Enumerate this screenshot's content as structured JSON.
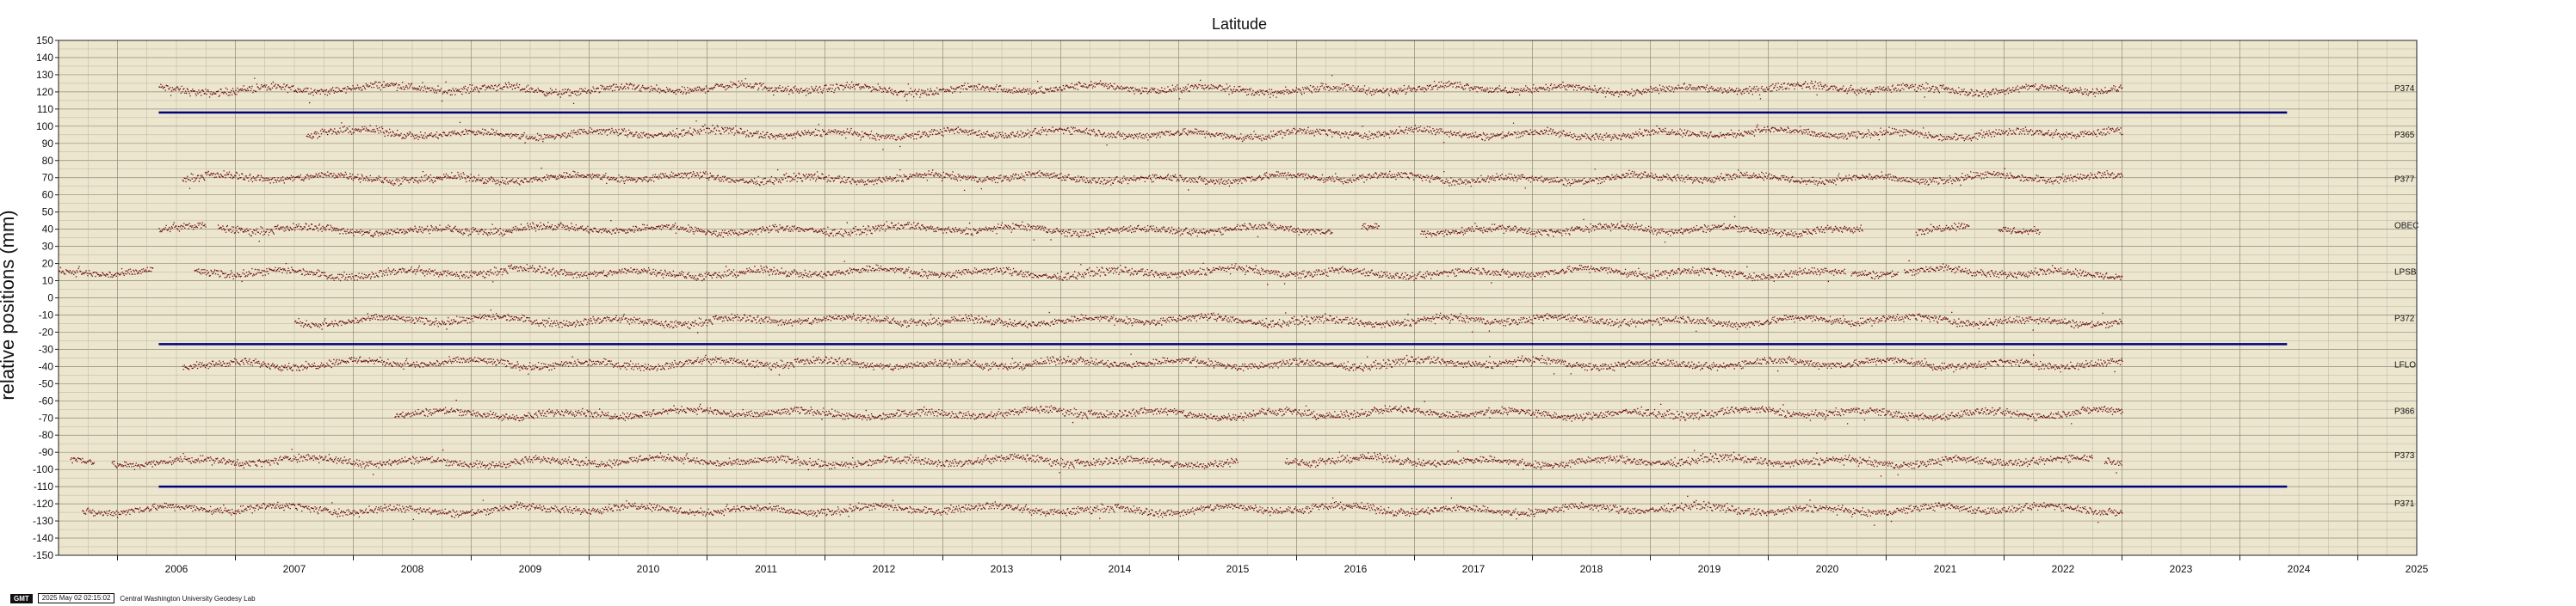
{
  "chart_data": {
    "type": "scatter",
    "title": "Latitude",
    "ylabel": "relative positions (mm)",
    "xlim": [
      2005.5,
      2025.5
    ],
    "ylim": [
      -150,
      150
    ],
    "y_ticks": [
      150,
      140,
      130,
      120,
      110,
      100,
      90,
      80,
      70,
      60,
      50,
      40,
      30,
      20,
      10,
      0,
      -10,
      -20,
      -30,
      -40,
      -50,
      -60,
      -70,
      -80,
      -90,
      -100,
      -110,
      -120,
      -130,
      -140,
      -150
    ],
    "x_ticks": [
      "2006",
      "2007",
      "2008",
      "2009",
      "2010",
      "2011",
      "2012",
      "2013",
      "2014",
      "2015",
      "2016",
      "2017",
      "2018",
      "2019",
      "2020",
      "2021",
      "2022",
      "2023",
      "2024",
      "2025"
    ],
    "grid": true,
    "background": "#ede6cf",
    "point_color": "#6b0c0c",
    "separator_color": "#000080",
    "separators": [
      {
        "y": 108,
        "x": [
          2006.35,
          2024.4
        ]
      },
      {
        "y": -27,
        "x": [
          2006.35,
          2024.4
        ]
      },
      {
        "y": -110,
        "x": [
          2006.35,
          2024.4
        ]
      }
    ],
    "series": [
      {
        "name": "P374",
        "label_y": 122,
        "offset": 122,
        "segments": [
          [
            2006.35,
            2023.0
          ]
        ]
      },
      {
        "name": "P365",
        "label_y": 95,
        "offset": 96,
        "segments": [
          [
            2007.6,
            2023.0
          ]
        ]
      },
      {
        "name": "P377",
        "label_y": 69,
        "offset": 70,
        "segments": [
          [
            2006.55,
            2023.0
          ]
        ]
      },
      {
        "name": "OBEC",
        "label_y": 42,
        "offset": 40,
        "segments": [
          [
            2006.35,
            2006.75
          ],
          [
            2006.85,
            2016.3
          ],
          [
            2016.55,
            2016.7
          ],
          [
            2017.05,
            2020.8
          ],
          [
            2021.25,
            2021.7
          ],
          [
            2021.95,
            2022.3
          ]
        ]
      },
      {
        "name": "LPSB",
        "label_y": 15,
        "offset": 15,
        "segments": [
          [
            2005.5,
            2006.3
          ],
          [
            2006.65,
            2020.65
          ],
          [
            2020.7,
            2021.1
          ],
          [
            2021.15,
            2023.0
          ]
        ]
      },
      {
        "name": "P372",
        "label_y": -12,
        "offset": -13,
        "segments": [
          [
            2007.5,
            2023.0
          ]
        ]
      },
      {
        "name": "LFLO",
        "label_y": -39,
        "offset": -38,
        "segments": [
          [
            2006.55,
            2023.0
          ]
        ]
      },
      {
        "name": "P366",
        "label_y": -66,
        "offset": -67,
        "segments": [
          [
            2008.35,
            2023.0
          ]
        ]
      },
      {
        "name": "P373",
        "label_y": -92,
        "offset": -95,
        "segments": [
          [
            2005.6,
            2005.8
          ],
          [
            2005.95,
            2015.5
          ],
          [
            2015.9,
            2022.75
          ],
          [
            2022.85,
            2023.0
          ]
        ]
      },
      {
        "name": "P371",
        "label_y": -120,
        "offset": -123,
        "segments": [
          [
            2005.7,
            2023.0
          ]
        ]
      }
    ]
  },
  "footer": {
    "logo": "GMT",
    "timestamp": "2025 May 02 02:15:02",
    "credit": "Central Washington University Geodesy Lab"
  }
}
